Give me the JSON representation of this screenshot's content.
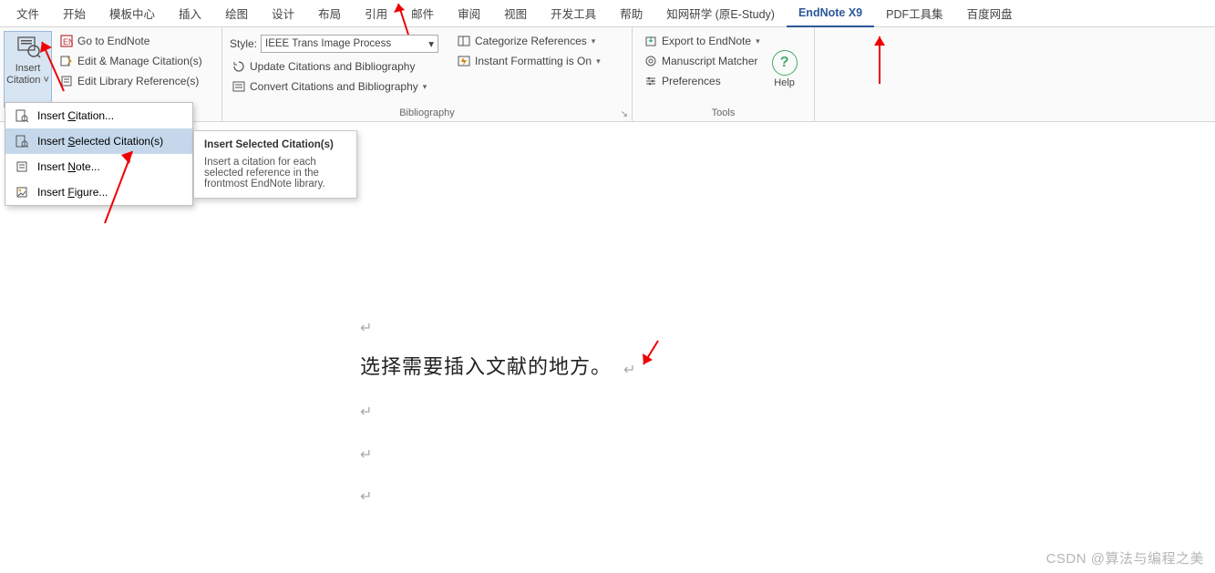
{
  "tabs": [
    "文件",
    "开始",
    "模板中心",
    "插入",
    "绘图",
    "设计",
    "布局",
    "引用",
    "邮件",
    "审阅",
    "视图",
    "开发工具",
    "帮助",
    "知网研学 (原E-Study)",
    "EndNote X9",
    "PDF工具集",
    "百度网盘"
  ],
  "active_tab_index": 14,
  "ribbon": {
    "insert_citation_label": "Insert Citation",
    "citations_group": {
      "go_to_endnote": "Go to EndNote",
      "edit_manage": "Edit & Manage Citation(s)",
      "edit_library_refs": "Edit Library Reference(s)"
    },
    "bibliography_group": {
      "label": "Bibliography",
      "style_label": "Style:",
      "style_value": "IEEE Trans Image Process",
      "update": "Update Citations and Bibliography",
      "convert": "Convert Citations and Bibliography",
      "categorize": "Categorize References",
      "instant_fmt": "Instant Formatting is On"
    },
    "tools_group": {
      "label": "Tools",
      "export": "Export to EndNote",
      "manuscript": "Manuscript Matcher",
      "preferences": "Preferences"
    },
    "help_label": "Help"
  },
  "dropdown": {
    "items": [
      {
        "pre": "Insert ",
        "u": "C",
        "post": "itation..."
      },
      {
        "pre": "Insert ",
        "u": "S",
        "post": "elected Citation(s)"
      },
      {
        "pre": "Insert ",
        "u": "N",
        "post": "ote..."
      },
      {
        "pre": "Insert ",
        "u": "F",
        "post": "igure..."
      }
    ],
    "highlight_index": 1
  },
  "tooltip": {
    "title": "Insert Selected Citation(s)",
    "body": "Insert a citation for each selected reference in the frontmost EndNote library."
  },
  "document": {
    "main_text": "选择需要插入文献的地方。",
    "empty_lines": 4
  },
  "watermark": "CSDN @算法与编程之美"
}
